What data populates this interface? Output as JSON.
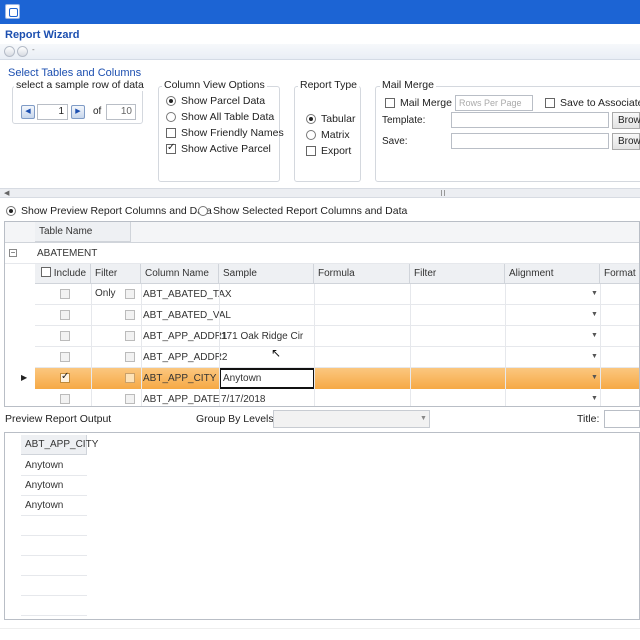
{
  "window": {
    "title": "Report Wizard"
  },
  "select_section": {
    "label": "Select Tables and Columns",
    "sample_row_group": {
      "title": "select a sample row of data",
      "current_row": "1",
      "of_label": "of",
      "total_rows": "10"
    },
    "column_view_options": {
      "title": "Column View Options",
      "options": [
        {
          "label": "Show Parcel Data",
          "selected": true
        },
        {
          "label": "Show All Table Data",
          "selected": false
        }
      ],
      "checkboxes": [
        {
          "label": "Show Friendly Names",
          "checked": false
        },
        {
          "label": "Show Active Parcel",
          "checked": true
        }
      ]
    },
    "report_type": {
      "title": "Report Type",
      "options": [
        {
          "label": "Tabular",
          "selected": true
        },
        {
          "label": "Matrix",
          "selected": false
        }
      ],
      "export_label": "Export"
    },
    "mail_merge": {
      "title": "Mail Merge",
      "mail_merge_label": "Mail Merge",
      "rows_per_page_placeholder": "Rows Per Page",
      "save_to_associated_label": "Save to Associated",
      "template_label": "Template:",
      "save_label": "Save:",
      "browse_label": "Brow"
    }
  },
  "preview_toggle": {
    "option1": "Show Preview Report Columns and Data",
    "option2": "Show Selected Report Columns and Data"
  },
  "grid": {
    "header": "Table Name",
    "group_name": "ABATEMENT",
    "columns": [
      "Include",
      "Filter Only",
      "Column Name",
      "Sample",
      "Formula",
      "Filter",
      "Alignment",
      "Format"
    ],
    "rows": [
      {
        "column_name": "ABT_ABATED_TAX",
        "sample": "",
        "include": false
      },
      {
        "column_name": "ABT_ABATED_VAL",
        "sample": "",
        "include": false
      },
      {
        "column_name": "ABT_APP_ADDR1",
        "sample": "171 Oak Ridge Cir",
        "include": false
      },
      {
        "column_name": "ABT_APP_ADDR2",
        "sample": "",
        "include": false
      },
      {
        "column_name": "ABT_APP_CITY",
        "sample": "Anytown",
        "include": true,
        "selected": true
      },
      {
        "column_name": "ABT_APP_DATE",
        "sample": "7/17/2018",
        "include": false
      }
    ]
  },
  "preview": {
    "label": "Preview Report Output",
    "group_by_label": "Group By Levels:",
    "title_label": "Title:",
    "column_header": "ABT_APP_CITY",
    "values": [
      "Anytown",
      "Anytown",
      "Anytown"
    ]
  }
}
